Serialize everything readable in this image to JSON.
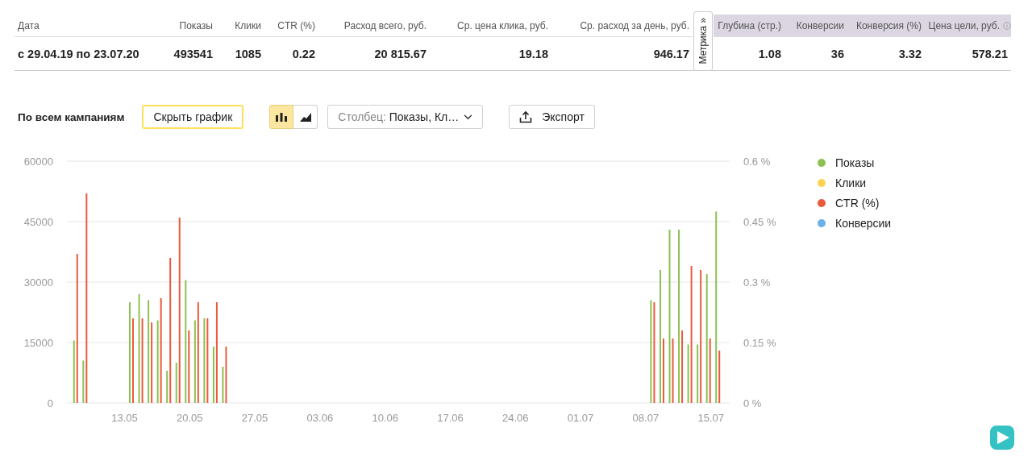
{
  "summary_table": {
    "columns": [
      {
        "label": "Дата",
        "metrika": false
      },
      {
        "label": "Показы",
        "metrika": false
      },
      {
        "label": "Клики",
        "metrika": false
      },
      {
        "label": "CTR (%)",
        "metrika": false
      },
      {
        "label": "Расход всего, руб.",
        "metrika": false
      },
      {
        "label": "Ср. цена клика, руб.",
        "metrika": false
      },
      {
        "label": "Ср. расход за день, руб.",
        "metrika": false
      },
      {
        "label": "Глубина (стр.)",
        "metrika": true
      },
      {
        "label": "Конверсии",
        "metrika": true
      },
      {
        "label": "Конверсия (%)",
        "metrika": true
      },
      {
        "label": "Цена цели, руб.",
        "metrika": true
      }
    ],
    "metrika_tab": {
      "label": "Метрика »"
    },
    "rows": [
      {
        "cells": [
          "с 29.04.19 по 23.07.20",
          "493541",
          "1085",
          "0.22",
          "20 815.67",
          "19.18",
          "946.17",
          "1.08",
          "36",
          "3.32",
          "578.21"
        ]
      }
    ]
  },
  "toolbar": {
    "title": "По всем кампаниям",
    "hide_chart_button": "Скрыть график",
    "view_toggle": [
      {
        "kind": "bar",
        "selected": true
      },
      {
        "kind": "area",
        "selected": false
      }
    ],
    "column_dropdown": {
      "label": "Столбец:",
      "value": "Показы, Кл…"
    },
    "export_button": "Экспорт"
  },
  "chart": {
    "chart_data": {
      "type": "bar",
      "categories": [
        null,
        null,
        null,
        null,
        null,
        "13.05",
        null,
        null,
        null,
        null,
        null,
        null,
        "20.05",
        null,
        null,
        null,
        null,
        null,
        null,
        "27.05",
        null,
        null,
        null,
        null,
        null,
        null,
        "03.06",
        null,
        null,
        null,
        null,
        null,
        null,
        "10.06",
        null,
        null,
        null,
        null,
        null,
        null,
        "17.06",
        null,
        null,
        null,
        null,
        null,
        null,
        "24.06",
        null,
        null,
        null,
        null,
        null,
        null,
        "01.07",
        null,
        null,
        null,
        null,
        null,
        null,
        "08.07",
        null,
        null,
        null,
        null,
        null,
        null,
        "15.07",
        null
      ],
      "series": [
        {
          "name": "Показы",
          "color": "#8cc152",
          "values": [
            15500,
            10500,
            null,
            null,
            null,
            null,
            25000,
            27000,
            25500,
            20500,
            8000,
            10000,
            30500,
            20500,
            21000,
            14000,
            9000,
            null,
            null,
            null,
            null,
            null,
            null,
            null,
            null,
            null,
            null,
            null,
            null,
            null,
            null,
            null,
            null,
            null,
            null,
            null,
            null,
            null,
            null,
            null,
            null,
            null,
            null,
            null,
            null,
            null,
            null,
            null,
            null,
            null,
            null,
            null,
            null,
            null,
            null,
            null,
            null,
            null,
            null,
            null,
            null,
            null,
            25500,
            33000,
            43000,
            43000,
            14500,
            14500,
            32000,
            47500
          ]
        },
        {
          "name": "Клики",
          "color": "#fdd451",
          "values": [
            null,
            null,
            null,
            null,
            null,
            null,
            null,
            null,
            null,
            null,
            null,
            null,
            null,
            null,
            null,
            null,
            null,
            null,
            null,
            null,
            null,
            null,
            null,
            null,
            null,
            null,
            null,
            null,
            null,
            null,
            null,
            null,
            null,
            null,
            null,
            null,
            null,
            null,
            null,
            null,
            null,
            null,
            null,
            null,
            null,
            null,
            null,
            null,
            null,
            null,
            null,
            null,
            null,
            null,
            null,
            null,
            null,
            null,
            null,
            null,
            null,
            null,
            null,
            null,
            null,
            null,
            null,
            null,
            null,
            null
          ]
        },
        {
          "name": "CTR (%)",
          "color": "#ea5a3c",
          "axis": "y2",
          "values": [
            0.37,
            0.52,
            null,
            null,
            null,
            null,
            0.21,
            0.21,
            0.2,
            0.26,
            0.36,
            0.46,
            0.18,
            0.25,
            0.21,
            0.25,
            0.14,
            null,
            null,
            null,
            null,
            null,
            null,
            null,
            null,
            null,
            null,
            null,
            null,
            null,
            null,
            null,
            null,
            null,
            null,
            null,
            null,
            null,
            null,
            null,
            null,
            null,
            null,
            null,
            null,
            null,
            null,
            null,
            null,
            null,
            null,
            null,
            null,
            null,
            null,
            null,
            null,
            null,
            null,
            null,
            null,
            null,
            0.25,
            0.16,
            0.16,
            0.18,
            0.34,
            0.33,
            0.16,
            0.13
          ]
        },
        {
          "name": "Конверсии",
          "color": "#6cb0e8",
          "values": [
            null,
            null,
            null,
            null,
            null,
            null,
            null,
            null,
            null,
            null,
            null,
            null,
            null,
            null,
            null,
            null,
            null,
            null,
            null,
            null,
            null,
            null,
            null,
            null,
            null,
            null,
            null,
            null,
            null,
            null,
            null,
            null,
            null,
            null,
            null,
            null,
            null,
            null,
            null,
            null,
            null,
            null,
            null,
            null,
            null,
            null,
            null,
            null,
            null,
            null,
            null,
            null,
            null,
            null,
            null,
            null,
            null,
            null,
            null,
            null,
            null,
            null,
            null,
            null,
            null,
            null,
            null,
            null,
            null,
            null
          ]
        }
      ],
      "grid": true,
      "ylim": [
        0,
        60000
      ],
      "yticks": [
        0,
        15000,
        30000,
        45000,
        60000
      ],
      "y2lim": [
        0,
        0.6
      ],
      "y2ticks": [
        {
          "value": 0,
          "label": "0 %"
        },
        {
          "value": 0.15,
          "label": "0.15 %"
        },
        {
          "value": 0.3,
          "label": "0.3 %"
        },
        {
          "value": 0.45,
          "label": "0.45 %"
        },
        {
          "value": 0.6,
          "label": "0.6 %"
        }
      ]
    }
  }
}
